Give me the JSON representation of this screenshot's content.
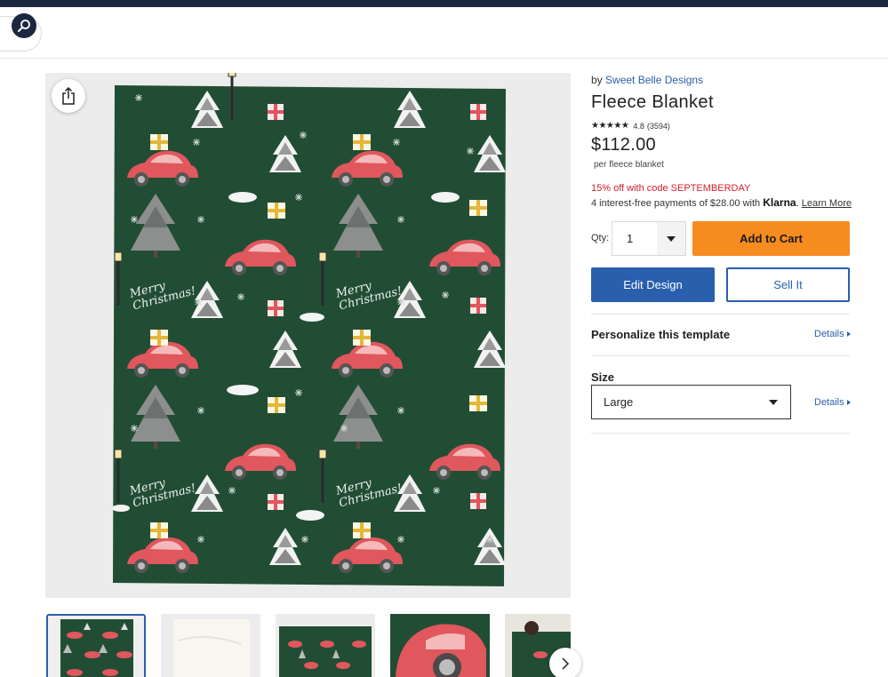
{
  "header": {
    "search_icon": "magnifier-icon",
    "colors": {
      "navy": "#1c2740"
    }
  },
  "product": {
    "by_prefix": "by",
    "seller": "Sweet Belle Designs",
    "title": "Fleece Blanket",
    "stars": "★★★★★",
    "rating": "4.8",
    "review_count": "(3594)",
    "price": "$112.00",
    "price_unit": "per fleece blanket",
    "promo": "15% off with code SEPTEMBERDAY",
    "klarna_text": "4 interest-free payments of $28.00 with",
    "klarna_brand": "Klarna",
    "klarna_link": "Learn More"
  },
  "artwork": {
    "greeting_line1": "Merry",
    "greeting_line2": "Christmas!",
    "background_color": "#224d35"
  },
  "purchase": {
    "qty_label": "Qty:",
    "qty_value": "1",
    "add_to_cart": "Add to Cart",
    "edit_design": "Edit Design",
    "sell_it": "Sell It"
  },
  "options": {
    "personalize_title": "Personalize this template",
    "personalize_details": "Details",
    "size_title": "Size",
    "size_value": "Large",
    "size_details": "Details"
  },
  "colors": {
    "accent_blue": "#2a5fad",
    "cart_orange": "#f68b1f",
    "promo_red": "#d0202e",
    "car_red": "#e0575d"
  }
}
